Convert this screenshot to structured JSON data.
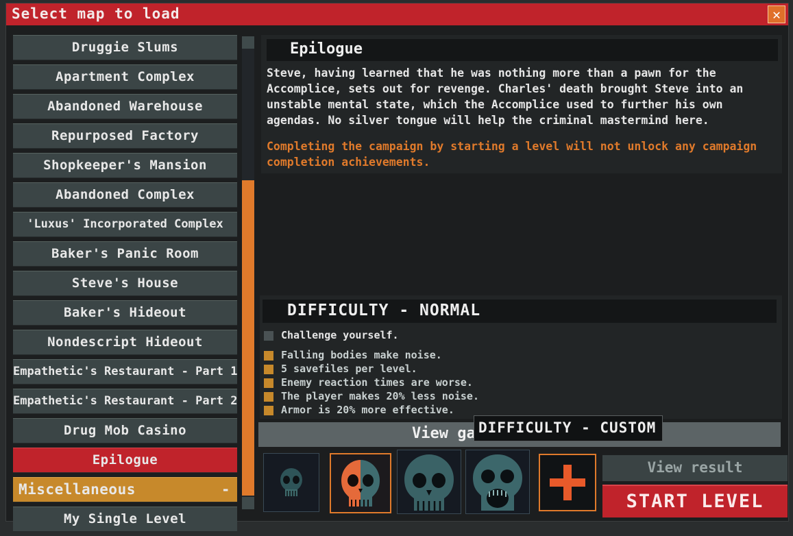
{
  "window": {
    "title": "Select map to load",
    "close_glyph": "✕"
  },
  "maps": [
    {
      "label": "Druggie Slums"
    },
    {
      "label": "Apartment Complex"
    },
    {
      "label": "Abandoned Warehouse"
    },
    {
      "label": "Repurposed Factory"
    },
    {
      "label": "Shopkeeper's Mansion"
    },
    {
      "label": "Abandoned Complex"
    },
    {
      "label": "'Luxus' Incorporated Complex"
    },
    {
      "label": "Baker's Panic Room"
    },
    {
      "label": "Steve's House"
    },
    {
      "label": "Baker's Hideout"
    },
    {
      "label": "Nondescript Hideout"
    },
    {
      "label": "Empathetic's Restaurant - Part 1"
    },
    {
      "label": "Empathetic's Restaurant - Part 2"
    },
    {
      "label": "Drug Mob Casino"
    },
    {
      "label": "Epilogue"
    }
  ],
  "category": {
    "label": "Miscellaneous",
    "toggle": "-"
  },
  "custom_maps": [
    {
      "label": "My Single Level"
    }
  ],
  "selected_map": "Epilogue",
  "description": {
    "title": "Epilogue",
    "text": "Steve, having learned that he was nothing more than a pawn for the Accomplice, sets out for revenge. Charles' death brought Steve into an unstable mental state, which the Accomplice used to further his own agendas. No silver tongue will help the criminal mastermind here.",
    "warning": "Completing the campaign by starting a level will not unlock any campaign completion achievements."
  },
  "difficulty": {
    "title": "DIFFICULTY - NORMAL",
    "challenge_label": "Challenge yourself.",
    "modifiers": [
      "Falling bodies make noise.",
      "5 savefiles per level.",
      "Enemy reaction times are worse.",
      "The player makes 20% less noise.",
      "Armor is 20% more effective."
    ],
    "view_label": "View ga",
    "tooltip": "DIFFICULTY - CUSTOM",
    "presets": [
      "skull-small-icon",
      "skull-split-icon",
      "skull-large-icon",
      "skull-screaming-icon"
    ],
    "add_icon": "plus-icon"
  },
  "actions": {
    "view_result": "View result",
    "start_level": "START LEVEL"
  },
  "colors": {
    "accent_red": "#c0232b",
    "accent_orange": "#e07a2b",
    "category_gold": "#c7892b"
  }
}
